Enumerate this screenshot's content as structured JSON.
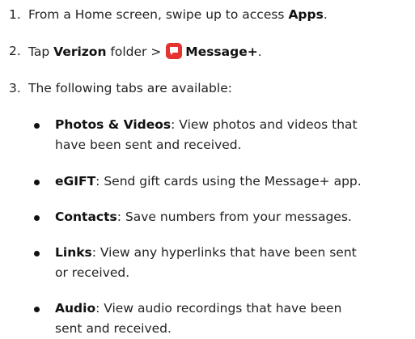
{
  "steps": [
    {
      "number": "1.",
      "text_before": "From a Home screen, swipe up to access ",
      "bold": "Apps",
      "text_after": "."
    },
    {
      "number": "2.",
      "text_before": "Tap ",
      "bold_folder": "Verizon",
      "text_mid": " folder > ",
      "bold_app": "Message+",
      "text_after": ".",
      "icon": "message-plus-app-icon"
    },
    {
      "number": "3.",
      "text": "The following tabs are available:"
    }
  ],
  "tabs": [
    {
      "title": "Photos & Videos",
      "lines": [
        ": View photos and videos that",
        "have been sent and received."
      ]
    },
    {
      "title": "eGIFT",
      "lines": [
        ": Send gift cards using the Message+ app."
      ]
    },
    {
      "title": "Contacts",
      "lines": [
        ": Save numbers from your messages."
      ]
    },
    {
      "title": "Links",
      "lines": [
        ": View any hyperlinks that have been sent",
        "or received."
      ]
    },
    {
      "title": "Audio",
      "lines": [
        ": View audio recordings that have been",
        "sent and received."
      ]
    }
  ],
  "colors": {
    "text": "#222222",
    "icon_red": "#e5342f"
  }
}
